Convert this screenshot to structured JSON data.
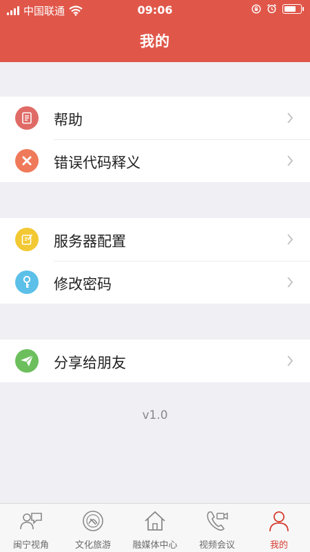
{
  "status": {
    "carrier": "中国联通",
    "time": "09:06",
    "battery_percent": 85
  },
  "header": {
    "title": "我的"
  },
  "groups": [
    {
      "items": [
        {
          "label": "帮助",
          "icon": "help-document-icon",
          "color": "#e06b66"
        },
        {
          "label": "错误代码释义",
          "icon": "error-x-icon",
          "color": "#ef7a5a"
        }
      ]
    },
    {
      "items": [
        {
          "label": "服务器配置",
          "icon": "edit-note-icon",
          "color": "#f2c833"
        },
        {
          "label": "修改密码",
          "icon": "key-icon",
          "color": "#5cc0e8"
        }
      ]
    },
    {
      "items": [
        {
          "label": "分享给朋友",
          "icon": "paper-plane-icon",
          "color": "#6cbf5c"
        }
      ]
    }
  ],
  "version": "v1.0",
  "tabs": [
    {
      "label": "闽宁视角",
      "icon": "people-chat-icon",
      "active": false
    },
    {
      "label": "文化旅游",
      "icon": "culture-emblem-icon",
      "active": false
    },
    {
      "label": "融媒体中心",
      "icon": "home-icon",
      "active": false
    },
    {
      "label": "视频会议",
      "icon": "video-call-icon",
      "active": false
    },
    {
      "label": "我的",
      "icon": "user-icon",
      "active": true
    }
  ],
  "colors": {
    "brand": "#e0574a",
    "active_tab": "#d63b2f",
    "background": "#efeff4"
  }
}
